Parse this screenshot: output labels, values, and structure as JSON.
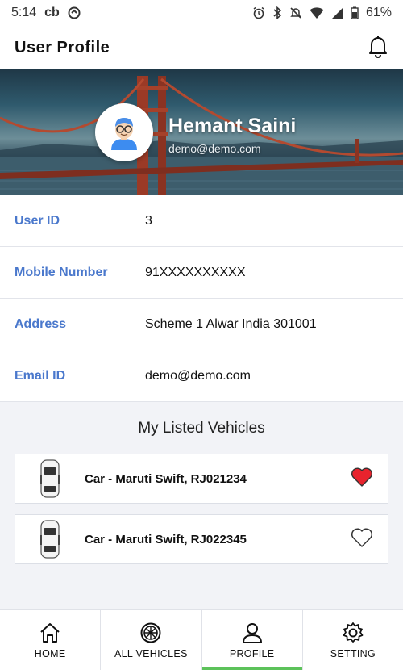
{
  "status_bar": {
    "time": "5:14",
    "carrier_badge": "cb",
    "battery": "61%",
    "icons": [
      "alarm-icon",
      "bluetooth-icon",
      "notifications-off-icon",
      "wifi-icon",
      "signal-icon",
      "battery-icon"
    ]
  },
  "header": {
    "title": "User Profile",
    "bell_icon": "bell-icon"
  },
  "profile": {
    "name": "Hemant Saini",
    "email": "demo@demo.com",
    "avatar_icon": "user-avatar-icon"
  },
  "details": [
    {
      "label": "User ID",
      "value": "3"
    },
    {
      "label": "Mobile Number",
      "value": "91XXXXXXXXXX"
    },
    {
      "label": "Address",
      "value": "Scheme 1 Alwar India 301001"
    },
    {
      "label": "Email ID",
      "value": "demo@demo.com"
    }
  ],
  "vehicles": {
    "title": "My Listed Vehicles",
    "items": [
      {
        "name": "Car - Maruti Swift, RJ021234",
        "favorite": true,
        "icon": "car-icon"
      },
      {
        "name": "Car - Maruti Swift, RJ022345",
        "favorite": false,
        "icon": "car-icon"
      }
    ]
  },
  "nav": {
    "items": [
      {
        "label": "HOME",
        "icon": "home-icon"
      },
      {
        "label": "ALL VEHICLES",
        "icon": "steering-wheel-icon"
      },
      {
        "label": "PROFILE",
        "icon": "person-icon",
        "active": true
      },
      {
        "label": "SETTING",
        "icon": "gear-icon"
      }
    ],
    "active_color": "#5cc25a"
  },
  "colors": {
    "label": "#4a78cc",
    "favorite": "#e8232d",
    "background": "#f2f3f7"
  }
}
